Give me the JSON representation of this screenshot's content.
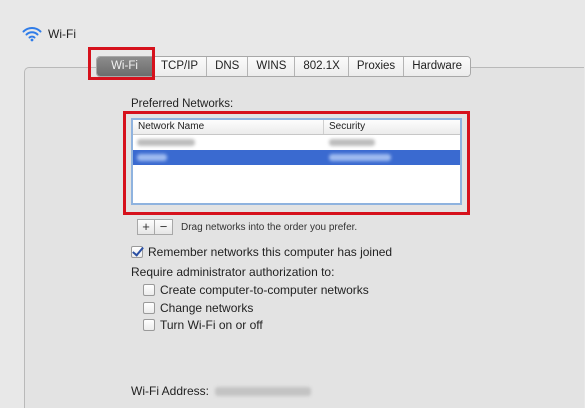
{
  "header": {
    "title": "Wi-Fi",
    "icon": "wifi-icon"
  },
  "tabs": [
    "Wi-Fi",
    "TCP/IP",
    "DNS",
    "WINS",
    "802.1X",
    "Proxies",
    "Hardware"
  ],
  "active_tab": "Wi-Fi",
  "preferred_networks": {
    "label": "Preferred Networks:",
    "columns": {
      "name": "Network Name",
      "security": "Security"
    },
    "add_label": "+",
    "remove_label": "−",
    "drag_hint": "Drag networks into the order you prefer."
  },
  "options": {
    "remember": {
      "label": "Remember networks this computer has joined",
      "checked": true
    },
    "require_label": "Require administrator authorization to:",
    "create": {
      "label": "Create computer-to-computer networks",
      "checked": false
    },
    "change": {
      "label": "Change networks",
      "checked": false
    },
    "toggle": {
      "label": "Turn Wi-Fi on or off",
      "checked": false
    }
  },
  "wifi_address": {
    "label": "Wi-Fi Address:"
  },
  "colors": {
    "highlight": "#d6111c",
    "selection": "#3a6ad0"
  }
}
